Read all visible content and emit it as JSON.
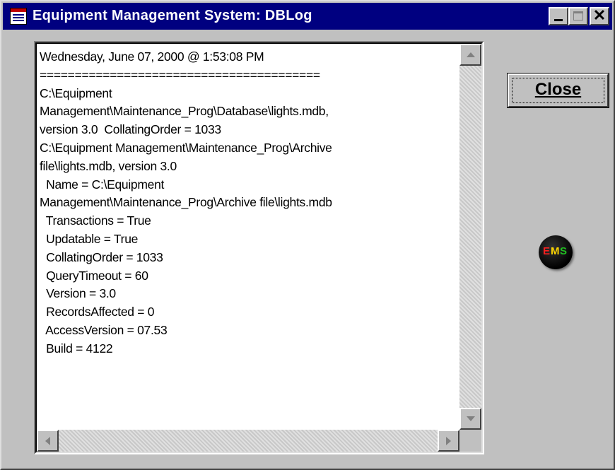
{
  "window": {
    "title": "Equipment Management System: DBLog",
    "icon": "document-icon",
    "controls": [
      "minimize-icon",
      "maximize-icon",
      "close-icon"
    ],
    "titlebar_color": "#000080",
    "face_color": "#c0c0c0"
  },
  "log": {
    "lines": [
      "Wednesday, June 07, 2000 @ 1:53:08 PM",
      "========================================",
      "C:\\Equipment",
      "Management\\Maintenance_Prog\\Database\\lights.mdb,",
      "version 3.0  CollatingOrder = 1033",
      "C:\\Equipment Management\\Maintenance_Prog\\Archive",
      "file\\lights.mdb, version 3.0",
      "  Name = C:\\Equipment",
      "Management\\Maintenance_Prog\\Archive file\\lights.mdb",
      "  Transactions = True",
      "  Updatable = True",
      "  CollatingOrder = 1033",
      "  QueryTimeout = 60",
      "  Version = 3.0",
      "  RecordsAffected = 0",
      "  AccessVersion = 07.53",
      "  Build = 4122"
    ]
  },
  "buttons": {
    "close_label": "Close"
  },
  "logo": {
    "letters": [
      {
        "ch": "E",
        "color": "#ff2020"
      },
      {
        "ch": "M",
        "color": "#ffd700"
      },
      {
        "ch": "S",
        "color": "#20c020"
      }
    ]
  }
}
